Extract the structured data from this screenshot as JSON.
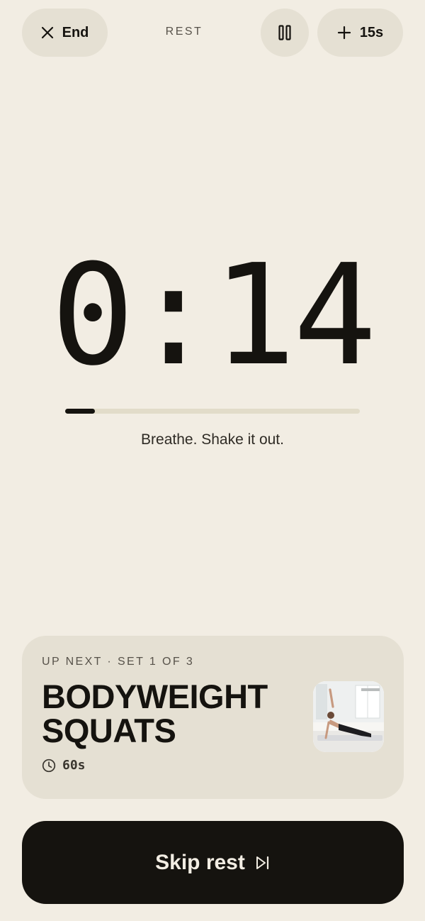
{
  "header": {
    "end_label": "End",
    "mode_label": "REST",
    "add_time_label": "+ 15s",
    "add_time_value": "15s"
  },
  "timer": {
    "display": "0:14",
    "progress": 0.1,
    "hint": "Breathe. Shake it out."
  },
  "up_next": {
    "eyebrow": "UP NEXT · SET 1 OF 3",
    "title": "BODYWEIGHT SQUATS",
    "duration": "60s"
  },
  "skip_button": {
    "label": "Skip rest"
  },
  "icons": {
    "end": "close-icon",
    "pause": "pause-icon",
    "add": "plus-icon",
    "duration": "clock-icon",
    "skip": "skip-forward-icon"
  },
  "colors": {
    "background": "#f2ede3",
    "surface": "#e5e0d3",
    "ink": "#15130f",
    "muted": "#57524a",
    "track": "#e2dcc9"
  }
}
